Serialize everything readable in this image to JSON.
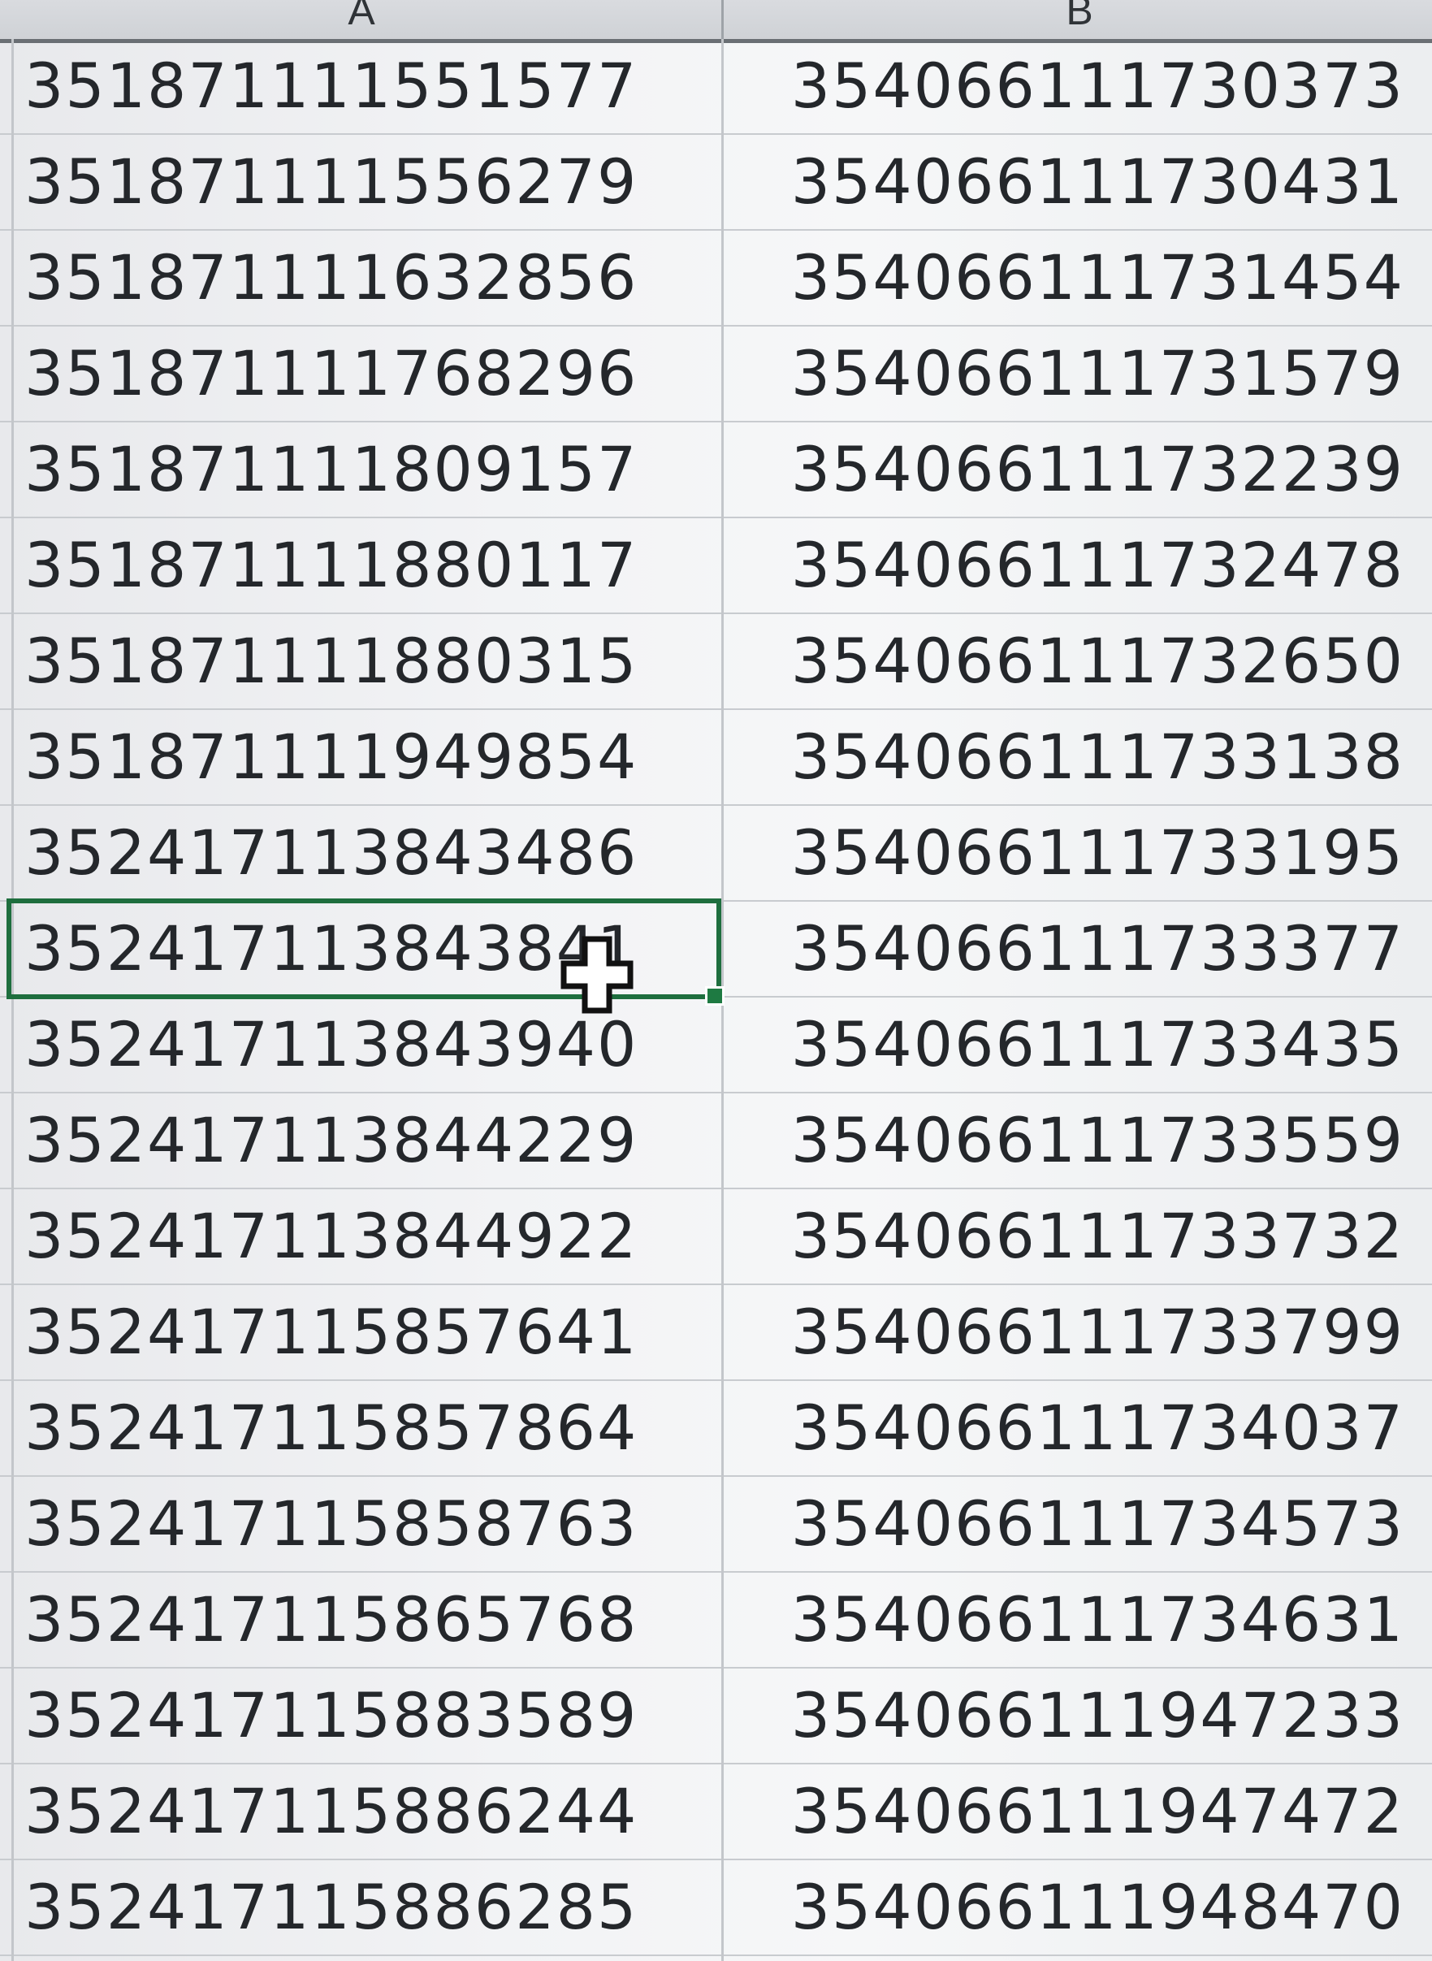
{
  "columns": {
    "a": {
      "header": "A"
    },
    "b": {
      "header": "B"
    }
  },
  "rows": [
    {
      "a": "351871111551577",
      "b": "354066111730373"
    },
    {
      "a": "351871111556279",
      "b": "354066111730431"
    },
    {
      "a": "351871111632856",
      "b": "354066111731454"
    },
    {
      "a": "351871111768296",
      "b": "354066111731579"
    },
    {
      "a": "351871111809157",
      "b": "354066111732239"
    },
    {
      "a": "351871111880117",
      "b": "354066111732478"
    },
    {
      "a": "351871111880315",
      "b": "354066111732650"
    },
    {
      "a": "351871111949854",
      "b": "354066111733138"
    },
    {
      "a": "352417113843486",
      "b": "354066111733195"
    },
    {
      "a": "352417113843841",
      "b": "354066111733377"
    },
    {
      "a": "352417113843940",
      "b": "354066111733435"
    },
    {
      "a": "352417113844229",
      "b": "354066111733559"
    },
    {
      "a": "352417113844922",
      "b": "354066111733732"
    },
    {
      "a": "352417115857641",
      "b": "354066111733799"
    },
    {
      "a": "352417115857864",
      "b": "354066111734037"
    },
    {
      "a": "352417115858763",
      "b": "354066111734573"
    },
    {
      "a": "352417115865768",
      "b": "354066111734631"
    },
    {
      "a": "352417115883589",
      "b": "354066111947233"
    },
    {
      "a": "352417115886244",
      "b": "354066111947472"
    },
    {
      "a": "352417115886285",
      "b": "354066111948470"
    }
  ],
  "selection": {
    "active_row_index": 9,
    "active_column": "A",
    "border_color": "#1e6e3e"
  },
  "cursor": {
    "icon": "cell-select-cross-cursor-icon"
  }
}
